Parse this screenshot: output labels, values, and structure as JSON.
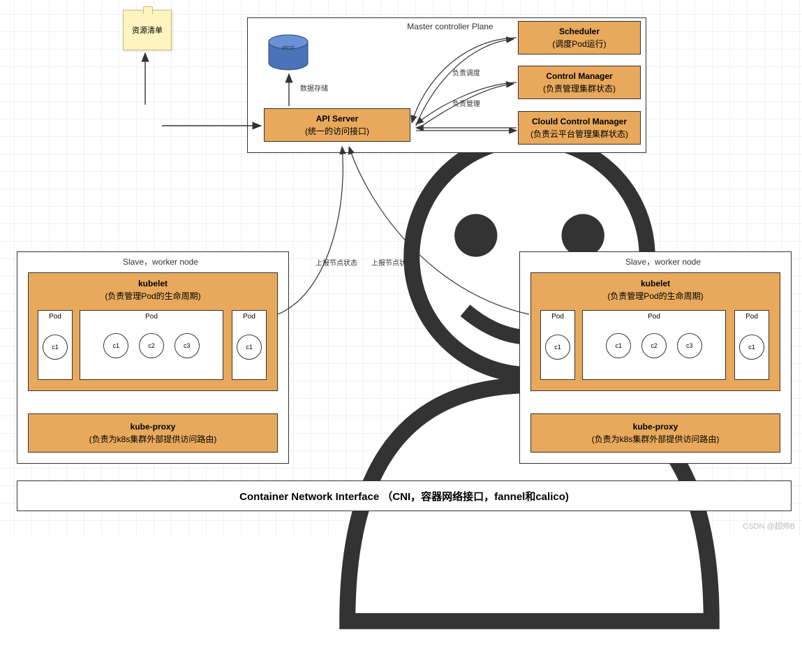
{
  "sticky_note": "资源清单",
  "master": {
    "title": "Master  controller Plane",
    "etcd_label": "etcd",
    "data_store_label": "数据存储",
    "schedule_label": "负责调度",
    "manage_label": "负责管理",
    "api_server": {
      "name": "API Server",
      "desc": "(统一的访问接口)"
    },
    "scheduler": {
      "name": "Scheduler",
      "desc": "(调度Pod运行)"
    },
    "control_manager": {
      "name": "Control Manager",
      "desc": "(负责管理集群状态)"
    },
    "cloud_control_manager": {
      "name": "Clould Control Manager",
      "desc": "(负责云平台管理集群状态)"
    }
  },
  "slave": {
    "title": "Slave，worker node",
    "kubelet": {
      "name": "kubelet",
      "desc": "(负责管理Pod的生命周期)"
    },
    "kube_proxy": {
      "name": "kube-proxy",
      "desc": "(负责为k8s集群外部提供访问路由)"
    },
    "pod_label": "Pod",
    "c1": "c1",
    "c2": "c2",
    "c3": "c3",
    "report_label": "上报节点状态"
  },
  "cni": "Container Network Interface  （CNI，容器网络接口，fannel和calico)",
  "watermark": "CSDN @超帅B"
}
